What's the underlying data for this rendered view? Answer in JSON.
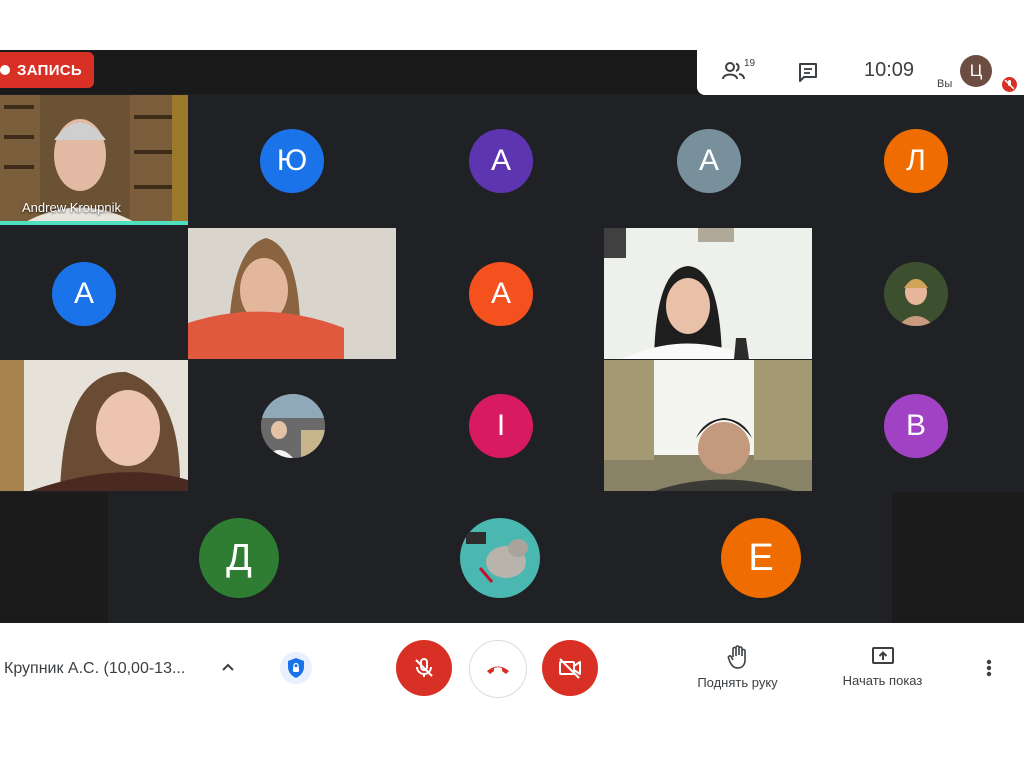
{
  "recording": {
    "label": "ЗАПИСЬ"
  },
  "topbar": {
    "participants_count": "19",
    "time": "10:09",
    "you_label": "Вы",
    "self_initial": "Ц"
  },
  "tiles": {
    "speaker_name": "Andrew Kroupnik",
    "row1": [
      "Ю",
      "А",
      "А",
      "Л"
    ],
    "row2": [
      "А",
      "А"
    ],
    "row3": [
      "I",
      "В"
    ],
    "row4": [
      "Д",
      "Е"
    ]
  },
  "colors": {
    "blue": "#1a73e8",
    "purple": "#5e35b1",
    "grey": "#78909c",
    "orange": "#ef6c00",
    "deep_orange": "#f4511e",
    "pink": "#d81b60",
    "violet": "#a142c4",
    "green": "#2e7d32"
  },
  "bottom": {
    "meeting_title": "Крупник А.С. (10,00-13...",
    "raise_hand": "Поднять руку",
    "present": "Начать показ"
  },
  "icons": [
    "people-icon",
    "chat-icon",
    "chevron-up-icon",
    "lock-icon",
    "mic-off-icon",
    "call-end-icon",
    "videocam-off-icon",
    "hand-icon",
    "present-icon",
    "more-vert-icon"
  ]
}
